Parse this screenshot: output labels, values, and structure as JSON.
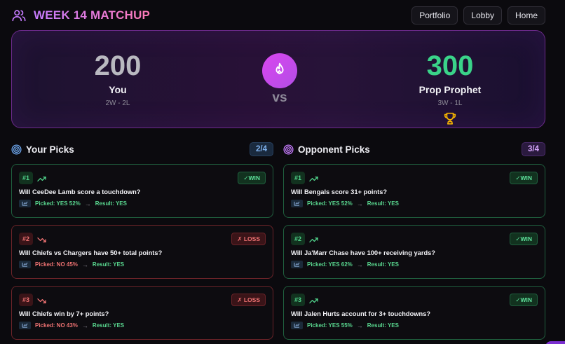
{
  "header": {
    "title": "WEEK 14 MATCHUP",
    "icon": "users-icon",
    "nav": [
      "Portfolio",
      "Lobby",
      "Home"
    ]
  },
  "matchup": {
    "you": {
      "score": "200",
      "name": "You",
      "record": "2W - 2L"
    },
    "opponent": {
      "score": "300",
      "name": "Prop Prophet",
      "record": "3W - 1L",
      "icon": "trophy-icon"
    },
    "center_icon": "flame-icon",
    "vs": "vs"
  },
  "your_picks": {
    "title": "Your Picks",
    "count": "2/4",
    "items": [
      {
        "num": "#1",
        "trend": "up",
        "status": "win",
        "badge": "✓WIN",
        "question": "Will CeeDee Lamb score a touchdown?",
        "picked": "Picked: YES 52%",
        "arrow": "→",
        "result": "Result: YES"
      },
      {
        "num": "#2",
        "trend": "down",
        "status": "loss",
        "badge": "✗ LOSS",
        "question": "Will Chiefs vs Chargers have 50+ total points?",
        "picked": "Picked: NO 45%",
        "arrow": "→",
        "result": "Result: YES"
      },
      {
        "num": "#3",
        "trend": "down",
        "status": "loss",
        "badge": "✗ LOSS",
        "question": "Will Chiefs win by 7+ points?",
        "picked": "Picked: NO 43%",
        "arrow": "→",
        "result": "Result: YES"
      }
    ]
  },
  "opponent_picks": {
    "title": "Opponent Picks",
    "count": "3/4",
    "items": [
      {
        "num": "#1",
        "trend": "up",
        "status": "win",
        "badge": "✓WIN",
        "question": "Will Bengals score 31+ points?",
        "picked": "Picked: YES 52%",
        "arrow": "→",
        "result": "Result: YES"
      },
      {
        "num": "#2",
        "trend": "up",
        "status": "win",
        "badge": "✓WIN",
        "question": "Will Ja'Marr Chase have 100+ receiving yards?",
        "picked": "Picked: YES 62%",
        "arrow": "→",
        "result": "Result: YES"
      },
      {
        "num": "#3",
        "trend": "up",
        "status": "win",
        "badge": "✓WIN",
        "question": "Will Jalen Hurts account for 3+ touchdowns?",
        "picked": "Picked: YES 55%",
        "arrow": "→",
        "result": "Result: YES"
      }
    ]
  },
  "colors": {
    "accent": "#c57bff",
    "win": "#59d78f",
    "loss": "#f07373",
    "opponent_score": "#3ad389"
  }
}
